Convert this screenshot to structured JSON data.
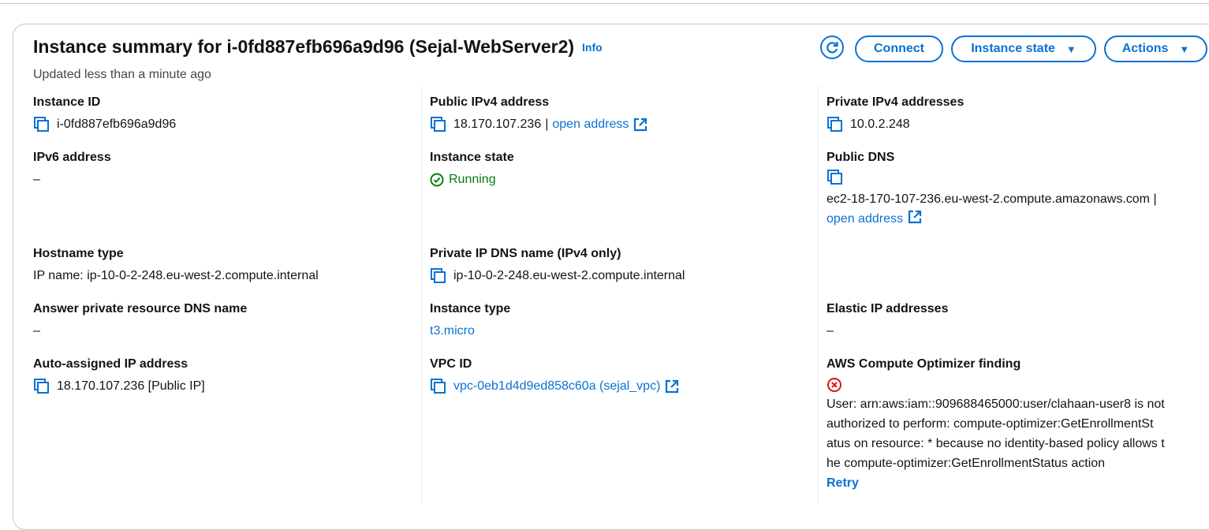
{
  "header": {
    "title": "Instance summary for i-0fd887efb696a9d96 (Sejal-WebServer2)",
    "info_label": "Info",
    "updated": "Updated less than a minute ago"
  },
  "buttons": {
    "connect": "Connect",
    "instance_state": "Instance state",
    "actions": "Actions"
  },
  "col1": {
    "instance_id": {
      "label": "Instance ID",
      "value": "i-0fd887efb696a9d96"
    },
    "ipv6": {
      "label": "IPv6 address",
      "value": "–"
    },
    "hostname_type": {
      "label": "Hostname type",
      "value": "IP name: ip-10-0-2-248.eu-west-2.compute.internal"
    },
    "answer_dns": {
      "label": "Answer private resource DNS name",
      "value": "–"
    },
    "auto_ip": {
      "label": "Auto-assigned IP address",
      "value": "18.170.107.236 [Public IP]"
    }
  },
  "col2": {
    "public_ipv4": {
      "label": "Public IPv4 address",
      "value": "18.170.107.236",
      "sep": "|",
      "link": "open address"
    },
    "instance_state": {
      "label": "Instance state",
      "value": "Running"
    },
    "private_dns": {
      "label": "Private IP DNS name (IPv4 only)",
      "value": "ip-10-0-2-248.eu-west-2.compute.internal"
    },
    "instance_type": {
      "label": "Instance type",
      "value": "t3.micro"
    },
    "vpc_id": {
      "label": "VPC ID",
      "value": "vpc-0eb1d4d9ed858c60a (sejal_vpc)"
    }
  },
  "col3": {
    "private_ipv4": {
      "label": "Private IPv4 addresses",
      "value": "10.0.2.248"
    },
    "public_dns": {
      "label": "Public DNS",
      "value": "ec2-18-170-107-236.eu-west-2.compute.amazonaws.com |",
      "link": "open address"
    },
    "elastic_ip": {
      "label": "Elastic IP addresses",
      "value": "–"
    },
    "optimizer": {
      "label": "AWS Compute Optimizer finding",
      "error_lines": [
        "User: arn:aws:iam::909688465000:user/clahaan-user8 is not",
        "authorized to perform: compute-optimizer:GetEnrollmentSt",
        "atus on resource: * because no identity-based policy allows t",
        "he compute-optimizer:GetEnrollmentStatus action"
      ],
      "retry": "Retry"
    }
  },
  "colors": {
    "link": "#0972d3",
    "success": "#037f0c",
    "error": "#d91515"
  }
}
